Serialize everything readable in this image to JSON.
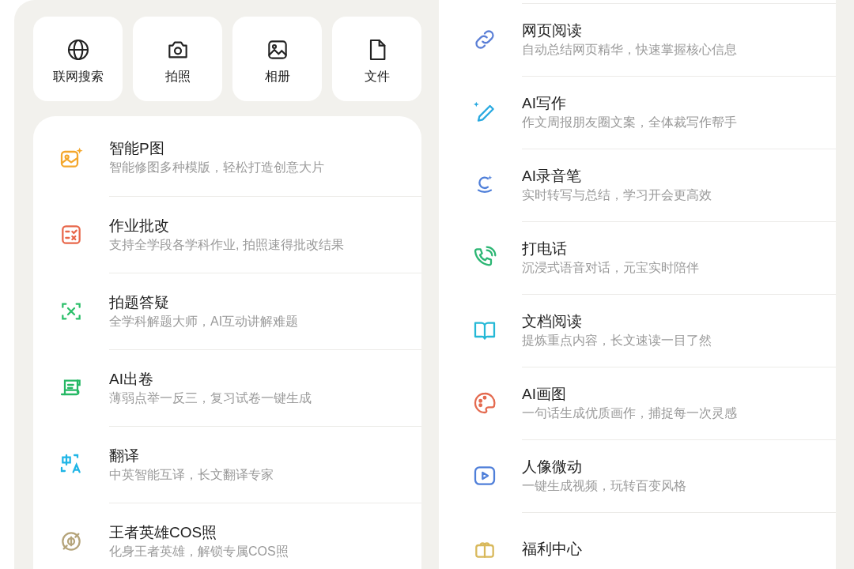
{
  "quick_actions": [
    {
      "label": "联网搜索"
    },
    {
      "label": "拍照"
    },
    {
      "label": "相册"
    },
    {
      "label": "文件"
    }
  ],
  "left_features": [
    {
      "title": "智能P图",
      "subtitle": "智能修图多种模版，轻松打造创意大片"
    },
    {
      "title": "作业批改",
      "subtitle": "支持全学段各学科作业, 拍照速得批改结果"
    },
    {
      "title": "拍题答疑",
      "subtitle": "全学科解题大师，AI互动讲解难题"
    },
    {
      "title": "AI出卷",
      "subtitle": "薄弱点举一反三，复习试卷一键生成"
    },
    {
      "title": "翻译",
      "subtitle": "中英智能互译，长文翻译专家"
    },
    {
      "title": "王者英雄COS照",
      "subtitle": "化身王者英雄，解锁专属COS照"
    }
  ],
  "right_features": [
    {
      "title": "网页阅读",
      "subtitle": "自动总结网页精华，快速掌握核心信息"
    },
    {
      "title": "AI写作",
      "subtitle": "作文周报朋友圈文案，全体裁写作帮手"
    },
    {
      "title": "AI录音笔",
      "subtitle": "实时转写与总结，学习开会更高效"
    },
    {
      "title": "打电话",
      "subtitle": "沉浸式语音对话，元宝实时陪伴"
    },
    {
      "title": "文档阅读",
      "subtitle": "提炼重点内容，长文速读一目了然"
    },
    {
      "title": "AI画图",
      "subtitle": "一句话生成优质画作，捕捉每一次灵感"
    },
    {
      "title": "人像微动",
      "subtitle": "一键生成视频，玩转百变风格"
    },
    {
      "title": "福利中心"
    }
  ]
}
